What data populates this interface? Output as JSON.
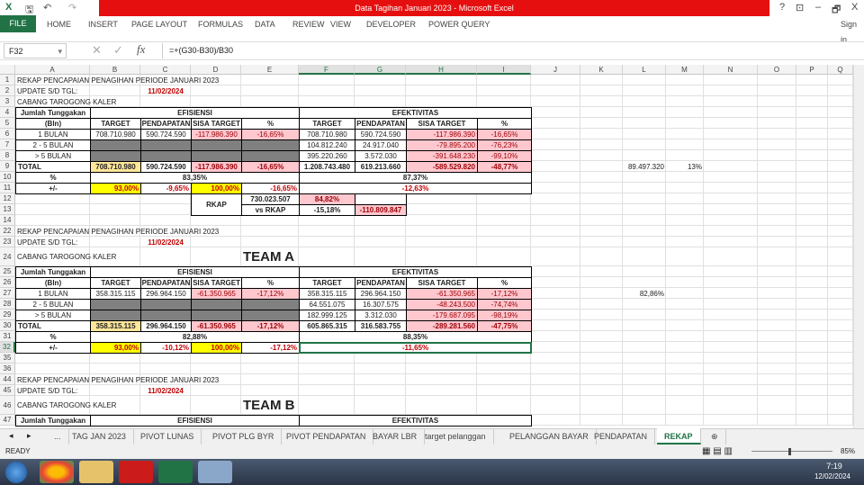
{
  "window": {
    "title": "Data Tagihan Januari 2023 - Microsoft Excel",
    "controls": [
      "?",
      "⊡",
      "–",
      "🗗",
      "X"
    ]
  },
  "ribbon": {
    "file": "FILE",
    "tabs": [
      "HOME",
      "INSERT",
      "PAGE LAYOUT",
      "FORMULAS",
      "DATA",
      "REVIEW",
      "VIEW",
      "DEVELOPER",
      "POWER QUERY"
    ],
    "sign_in": "Sign in"
  },
  "formula_bar": {
    "name_box": "F32",
    "formula": "=+(G30-B30)/B30",
    "fx": "fx"
  },
  "columns": [
    "A",
    "B",
    "C",
    "D",
    "E",
    "F",
    "G",
    "H",
    "I",
    "J",
    "K",
    "L",
    "M",
    "N",
    "O",
    "P",
    "Q"
  ],
  "selected": {
    "cols": [
      "F",
      "G",
      "H",
      "I"
    ],
    "row": "32"
  },
  "rows": [
    {
      "n": "1",
      "cells": [
        [
          "A",
          "REKAP PENCAPAIAN PENAGIHAN PERIODE JANUARI 2023",
          1,
          "l"
        ]
      ]
    },
    {
      "n": "2",
      "cells": [
        [
          "A",
          "UPDATE S/D TGL:",
          1,
          "l"
        ],
        [
          "C",
          "11/02/2024",
          1,
          "c red b"
        ]
      ]
    },
    {
      "n": "3",
      "cells": [
        [
          "A",
          "CABANG TAROGONG KALER",
          1,
          "l"
        ]
      ]
    },
    {
      "n": "4",
      "cells": [
        [
          "A",
          "Jumlah Tunggakan",
          1,
          "c b bd"
        ],
        [
          "B",
          "EFISIENSI",
          4,
          "c b bd"
        ],
        [
          "F",
          "EFEKTIVITAS",
          4,
          "c b bd"
        ]
      ]
    },
    {
      "n": "5",
      "cells": [
        [
          "A",
          "(Bln)",
          1,
          "c b bd"
        ],
        [
          "B",
          "TARGET",
          1,
          "c b bd"
        ],
        [
          "C",
          "PENDAPATAN",
          1,
          "c b bd"
        ],
        [
          "D",
          "SISA TARGET",
          1,
          "c b bd"
        ],
        [
          "E",
          "%",
          1,
          "c b bd"
        ],
        [
          "F",
          "TARGET",
          1,
          "c b bd"
        ],
        [
          "G",
          "PENDAPATAN",
          1,
          "c b bd"
        ],
        [
          "H",
          "SISA TARGET",
          1,
          "c b bd"
        ],
        [
          "I",
          "%",
          1,
          "c b bd"
        ]
      ]
    },
    {
      "n": "6",
      "cells": [
        [
          "A",
          "1 BULAN",
          1,
          "c bd"
        ],
        [
          "B",
          "708.710.980",
          1,
          "c bd"
        ],
        [
          "C",
          "590.724.590",
          1,
          "c bd"
        ],
        [
          "D",
          "-117.986.390",
          1,
          "c bd pink"
        ],
        [
          "E",
          "-16,65%",
          1,
          "c bd pink"
        ],
        [
          "F",
          "708.710.980",
          1,
          "c bd"
        ],
        [
          "G",
          "590.724.590",
          1,
          "c bd"
        ],
        [
          "H",
          "-117.986.390",
          1,
          "r bd pink"
        ],
        [
          "I",
          "-16,65%",
          1,
          "c bd pink"
        ]
      ]
    },
    {
      "n": "7",
      "cells": [
        [
          "A",
          "2 - 5 BULAN",
          1,
          "c bd"
        ],
        [
          "B",
          "",
          1,
          "bd gray"
        ],
        [
          "C",
          "",
          1,
          "bd gray"
        ],
        [
          "D",
          "",
          1,
          "bd gray"
        ],
        [
          "E",
          "",
          1,
          "bd gray"
        ],
        [
          "F",
          "104.812.240",
          1,
          "c bd"
        ],
        [
          "G",
          "24.917.040",
          1,
          "c bd"
        ],
        [
          "H",
          "-79.895.200",
          1,
          "r bd pink"
        ],
        [
          "I",
          "-76,23%",
          1,
          "c bd pink"
        ]
      ]
    },
    {
      "n": "8",
      "cells": [
        [
          "A",
          "> 5 BULAN",
          1,
          "c bd"
        ],
        [
          "B",
          "",
          1,
          "bd gray"
        ],
        [
          "C",
          "",
          1,
          "bd gray"
        ],
        [
          "D",
          "",
          1,
          "bd gray"
        ],
        [
          "E",
          "",
          1,
          "bd gray"
        ],
        [
          "F",
          "395.220.260",
          1,
          "c bd"
        ],
        [
          "G",
          "3.572.030",
          1,
          "c bd"
        ],
        [
          "H",
          "-391.648.230",
          1,
          "r bd pink"
        ],
        [
          "I",
          "-99,10%",
          1,
          "c bd pink"
        ]
      ]
    },
    {
      "n": "9",
      "cells": [
        [
          "A",
          "TOTAL",
          1,
          "l b bd"
        ],
        [
          "B",
          "708.710.980",
          1,
          "c bd orange"
        ],
        [
          "C",
          "590.724.590",
          1,
          "c b bd"
        ],
        [
          "D",
          "-117.986.390",
          1,
          "c b bd pink"
        ],
        [
          "E",
          "-16,65%",
          1,
          "c b bd pink"
        ],
        [
          "F",
          "1.208.743.480",
          1,
          "c b bd"
        ],
        [
          "G",
          "619.213.660",
          1,
          "c b bd"
        ],
        [
          "H",
          "-589.529.820",
          1,
          "r b bd pink"
        ],
        [
          "I",
          "-48,77%",
          1,
          "c b bd pink"
        ],
        [
          "L",
          "89.497.320",
          1,
          "r"
        ],
        [
          "M",
          "13%",
          1,
          "r"
        ]
      ]
    },
    {
      "n": "10",
      "cells": [
        [
          "A",
          "%",
          1,
          "c b bd"
        ],
        [
          "B",
          "83,35%",
          4,
          "c b bd"
        ],
        [
          "F",
          "87,37%",
          4,
          "c b bd"
        ]
      ]
    },
    {
      "n": "11",
      "cells": [
        [
          "A",
          "+/-",
          1,
          "c b bd"
        ],
        [
          "B",
          "93,00%",
          1,
          "r b bd yellow"
        ],
        [
          "C",
          "-9,65%",
          1,
          "r b bd red"
        ],
        [
          "D",
          "100,00%",
          1,
          "r b bd yellow"
        ],
        [
          "E",
          "-16,65%",
          1,
          "r b bd red"
        ],
        [
          "F",
          "-12,63%",
          4,
          "c b bd red"
        ]
      ]
    },
    {
      "n": "12",
      "cells": [
        [
          "D",
          "RKAP",
          1,
          "c b bd rs2"
        ],
        [
          "E",
          "730.023.507",
          1,
          "c b bd"
        ],
        [
          "F",
          "84,82%",
          1,
          "c b bd pink"
        ],
        [
          "G",
          "",
          1,
          "bd"
        ]
      ]
    },
    {
      "n": "13",
      "cells": [
        [
          "E",
          "vs RKAP",
          1,
          "c b bd"
        ],
        [
          "F",
          "-15,18%",
          1,
          "c b bd"
        ],
        [
          "G",
          "-110.809.847",
          1,
          "c b bd pink"
        ]
      ]
    },
    {
      "n": "14",
      "cells": []
    },
    {
      "n": "22",
      "cells": [
        [
          "A",
          "REKAP PENCAPAIAN PENAGIHAN PERIODE JANUARI 2023",
          1,
          "l"
        ]
      ]
    },
    {
      "n": "23",
      "cells": [
        [
          "A",
          "UPDATE S/D TGL:",
          1,
          "l"
        ],
        [
          "C",
          "11/02/2024",
          1,
          "c red b"
        ]
      ]
    },
    {
      "n": "24",
      "cells": [
        [
          "A",
          "CABANG TAROGONG KALER",
          1,
          "l"
        ],
        [
          "E",
          "TEAM A",
          1,
          "l big"
        ]
      ]
    },
    {
      "n": "25",
      "cells": [
        [
          "A",
          "Jumlah Tunggakan",
          1,
          "c b bd"
        ],
        [
          "B",
          "EFISIENSI",
          4,
          "c b bd"
        ],
        [
          "F",
          "EFEKTIVITAS",
          4,
          "c b bd"
        ]
      ]
    },
    {
      "n": "26",
      "cells": [
        [
          "A",
          "(Bln)",
          1,
          "c b bd"
        ],
        [
          "B",
          "TARGET",
          1,
          "c b bd"
        ],
        [
          "C",
          "PENDAPATAN",
          1,
          "c b bd"
        ],
        [
          "D",
          "SISA TARGET",
          1,
          "c b bd"
        ],
        [
          "E",
          "%",
          1,
          "c b bd"
        ],
        [
          "F",
          "TARGET",
          1,
          "c b bd"
        ],
        [
          "G",
          "PENDAPATAN",
          1,
          "c b bd"
        ],
        [
          "H",
          "SISA TARGET",
          1,
          "c b bd"
        ],
        [
          "I",
          "%",
          1,
          "c b bd"
        ]
      ]
    },
    {
      "n": "27",
      "cells": [
        [
          "A",
          "1 BULAN",
          1,
          "c bd"
        ],
        [
          "B",
          "358.315.115",
          1,
          "c bd"
        ],
        [
          "C",
          "296.964.150",
          1,
          "c bd"
        ],
        [
          "D",
          "-61.350.965",
          1,
          "c bd pink"
        ],
        [
          "E",
          "-17,12%",
          1,
          "c bd pink"
        ],
        [
          "F",
          "358.315.115",
          1,
          "c bd"
        ],
        [
          "G",
          "296.964.150",
          1,
          "c bd"
        ],
        [
          "H",
          "-61.350.965",
          1,
          "r bd pink"
        ],
        [
          "I",
          "-17,12%",
          1,
          "c bd pink"
        ],
        [
          "L",
          "82,86%",
          1,
          "r"
        ]
      ]
    },
    {
      "n": "28",
      "cells": [
        [
          "A",
          "2 - 5 BULAN",
          1,
          "c bd"
        ],
        [
          "B",
          "",
          1,
          "bd gray"
        ],
        [
          "C",
          "",
          1,
          "bd gray"
        ],
        [
          "D",
          "",
          1,
          "bd gray"
        ],
        [
          "E",
          "",
          1,
          "bd gray"
        ],
        [
          "F",
          "64.551.075",
          1,
          "c bd"
        ],
        [
          "G",
          "16.307.575",
          1,
          "c bd"
        ],
        [
          "H",
          "-48.243.500",
          1,
          "r bd pink"
        ],
        [
          "I",
          "-74,74%",
          1,
          "c bd pink"
        ]
      ]
    },
    {
      "n": "29",
      "cells": [
        [
          "A",
          "> 5 BULAN",
          1,
          "c bd"
        ],
        [
          "B",
          "",
          1,
          "bd gray"
        ],
        [
          "C",
          "",
          1,
          "bd gray"
        ],
        [
          "D",
          "",
          1,
          "bd gray"
        ],
        [
          "E",
          "",
          1,
          "bd gray"
        ],
        [
          "F",
          "182.999.125",
          1,
          "c bd"
        ],
        [
          "G",
          "3.312.030",
          1,
          "c bd"
        ],
        [
          "H",
          "-179.687.095",
          1,
          "r bd pink"
        ],
        [
          "I",
          "-98,19%",
          1,
          "c bd pink"
        ]
      ]
    },
    {
      "n": "30",
      "cells": [
        [
          "A",
          "TOTAL",
          1,
          "l b bd"
        ],
        [
          "B",
          "358.315.115",
          1,
          "c bd orange"
        ],
        [
          "C",
          "296.964.150",
          1,
          "c b bd"
        ],
        [
          "D",
          "-61.350.965",
          1,
          "c b bd pink"
        ],
        [
          "E",
          "-17,12%",
          1,
          "c b bd pink"
        ],
        [
          "F",
          "605.865.315",
          1,
          "c b bd"
        ],
        [
          "G",
          "316.583.755",
          1,
          "c b bd"
        ],
        [
          "H",
          "-289.281.560",
          1,
          "r b bd pink"
        ],
        [
          "I",
          "-47,75%",
          1,
          "c b bd pink"
        ]
      ]
    },
    {
      "n": "31",
      "cells": [
        [
          "A",
          "%",
          1,
          "c b bd"
        ],
        [
          "B",
          "82,88%",
          4,
          "c b bd"
        ],
        [
          "F",
          "88,35%",
          4,
          "c b bd"
        ]
      ]
    },
    {
      "n": "32",
      "cells": [
        [
          "A",
          "+/-",
          1,
          "c b bd"
        ],
        [
          "B",
          "93,00%",
          1,
          "r b bd yellow"
        ],
        [
          "C",
          "-10,12%",
          1,
          "r b bd red"
        ],
        [
          "D",
          "100,00%",
          1,
          "r b bd yellow"
        ],
        [
          "E",
          "-17,12%",
          1,
          "r b bd red"
        ],
        [
          "F",
          "-11,65%",
          4,
          "c b bd red active"
        ]
      ]
    },
    {
      "n": "35",
      "cells": []
    },
    {
      "n": "36",
      "cells": []
    },
    {
      "n": "44",
      "cells": [
        [
          "A",
          "REKAP PENCAPAIAN PENAGIHAN PERIODE JANUARI 2023",
          1,
          "l"
        ]
      ]
    },
    {
      "n": "45",
      "cells": [
        [
          "A",
          "UPDATE S/D TGL:",
          1,
          "l"
        ],
        [
          "C",
          "11/02/2024",
          1,
          "c red b"
        ]
      ]
    },
    {
      "n": "46",
      "cells": [
        [
          "A",
          "CABANG TAROGONG KALER",
          1,
          "l"
        ],
        [
          "E",
          "TEAM B",
          1,
          "l big"
        ]
      ]
    },
    {
      "n": "47",
      "cells": [
        [
          "A",
          "Jumlah Tunggakan",
          1,
          "c b bd"
        ],
        [
          "B",
          "EFISIENSI",
          4,
          "c b bd"
        ],
        [
          "F",
          "EFEKTIVITAS",
          4,
          "c b bd"
        ]
      ]
    }
  ],
  "sheet_tabs": {
    "more": "...",
    "tabs": [
      "TAG JAN 2023",
      "PIVOT LUNAS",
      "PIVOT PLG BYR",
      "PIVOT PENDAPATAN",
      "BAYAR LBR",
      "target pelanggan",
      "PELANGGAN BAYAR",
      "PENDAPATAN",
      "REKAP"
    ],
    "active": "REKAP",
    "add": "⊕"
  },
  "status": {
    "mode": "READY",
    "zoom": "85%"
  },
  "taskbar": {
    "time": "7:19",
    "date": "12/02/2024"
  }
}
